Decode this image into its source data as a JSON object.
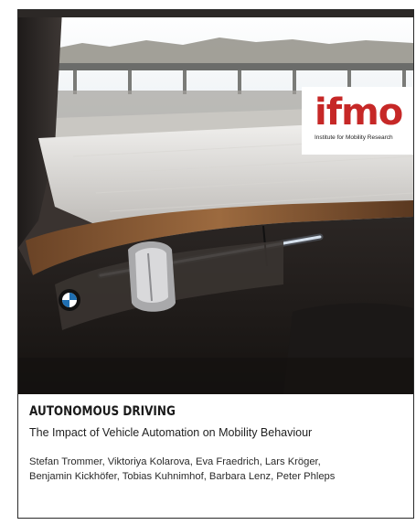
{
  "logo": {
    "brand": "ifmo",
    "tagline": "Institute for Mobility Research",
    "color": "#c62827"
  },
  "cover": {
    "title": "AUTONOMOUS DRIVING",
    "subtitle": "The Impact of Vehicle Automation on Mobility Behaviour",
    "authors_line1": "Stefan Trommer, Viktoriya Kolarova, Eva Fraedrich, Lars Kröger,",
    "authors_line2": "Benjamin Kickhöfer, Tobias Kuhnimhof, Barbara Lenz, Peter Phleps"
  },
  "photo": {
    "subject": "car-interior-dashboard-image",
    "badge_icon": "bmw-logo-icon"
  }
}
